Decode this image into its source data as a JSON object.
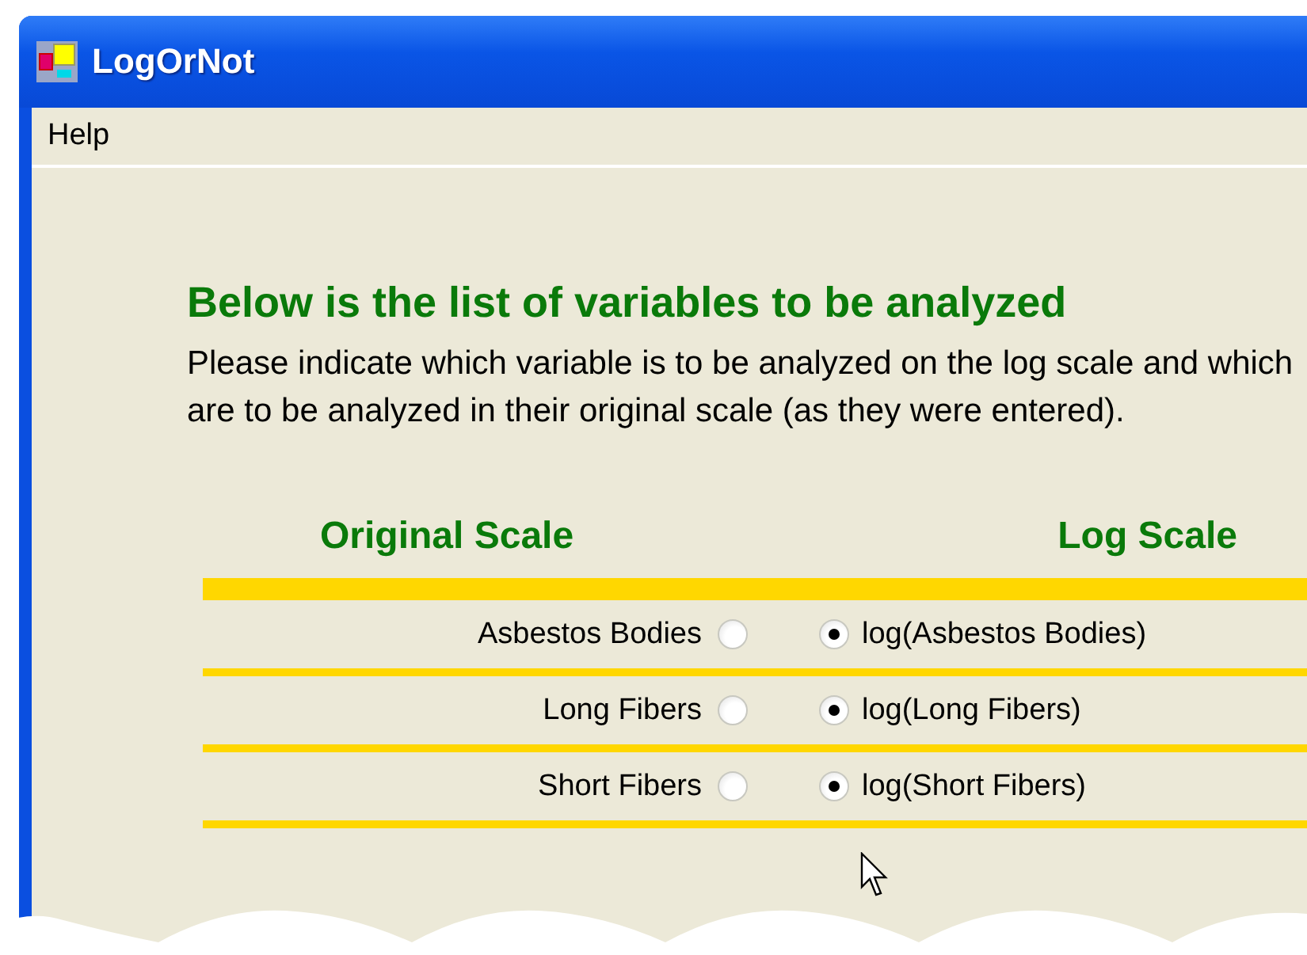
{
  "window": {
    "title": "LogOrNot"
  },
  "menu": [
    {
      "label": "Help"
    }
  ],
  "heading": "Below is the list of variables to be analyzed",
  "instructions": "Please indicate which variable is to be analyzed on the log scale and which are to be analyzed in their original scale (as they were entered).",
  "columns": {
    "original": "Original Scale",
    "log": "Log Scale"
  },
  "variables": [
    {
      "original": {
        "label": "Asbestos Bodies",
        "selected": false
      },
      "log": {
        "label": "log(Asbestos Bodies)",
        "selected": true
      }
    },
    {
      "original": {
        "label": "Long Fibers",
        "selected": false
      },
      "log": {
        "label": "log(Long Fibers)",
        "selected": true
      }
    },
    {
      "original": {
        "label": "Short Fibers",
        "selected": false
      },
      "log": {
        "label": "log(Short Fibers)",
        "selected": true
      }
    }
  ]
}
